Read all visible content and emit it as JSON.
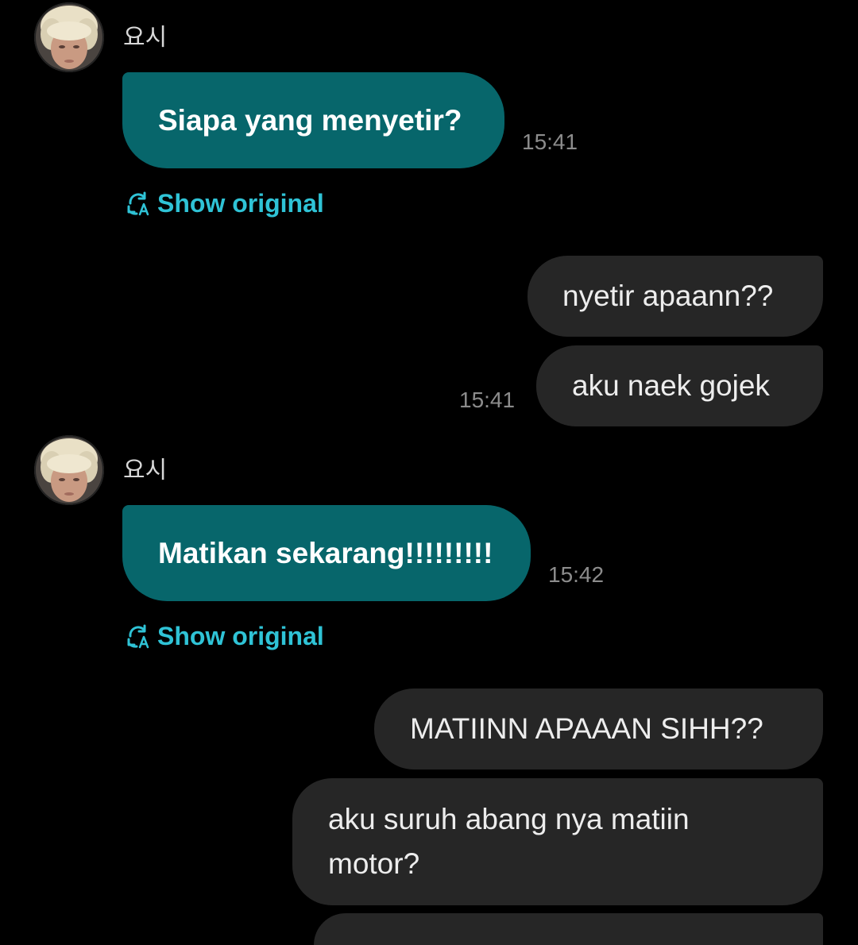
{
  "colors": {
    "background": "#000000",
    "incoming_bubble": "#07666b",
    "outgoing_bubble": "#262626",
    "link": "#2fc3d6",
    "timestamp": "#8c8c8c"
  },
  "messages": [
    {
      "direction": "incoming",
      "sender": "요시",
      "avatar_icon": "profile-photo",
      "text": "Siapa yang menyetir?",
      "time": "15:41",
      "show_original_label": "Show original",
      "show_original_icon": "translate-icon"
    },
    {
      "direction": "outgoing",
      "texts": [
        "nyetir apaann??",
        "aku naek gojek"
      ],
      "time": "15:41"
    },
    {
      "direction": "incoming",
      "sender": "요시",
      "avatar_icon": "profile-photo",
      "text": "Matikan sekarang!!!!!!!!!",
      "time": "15:42",
      "show_original_label": "Show original",
      "show_original_icon": "translate-icon"
    },
    {
      "direction": "outgoing",
      "texts": [
        "MATIINN APAAAN SIHH??",
        "aku suruh abang nya matiin motor?"
      ]
    }
  ]
}
